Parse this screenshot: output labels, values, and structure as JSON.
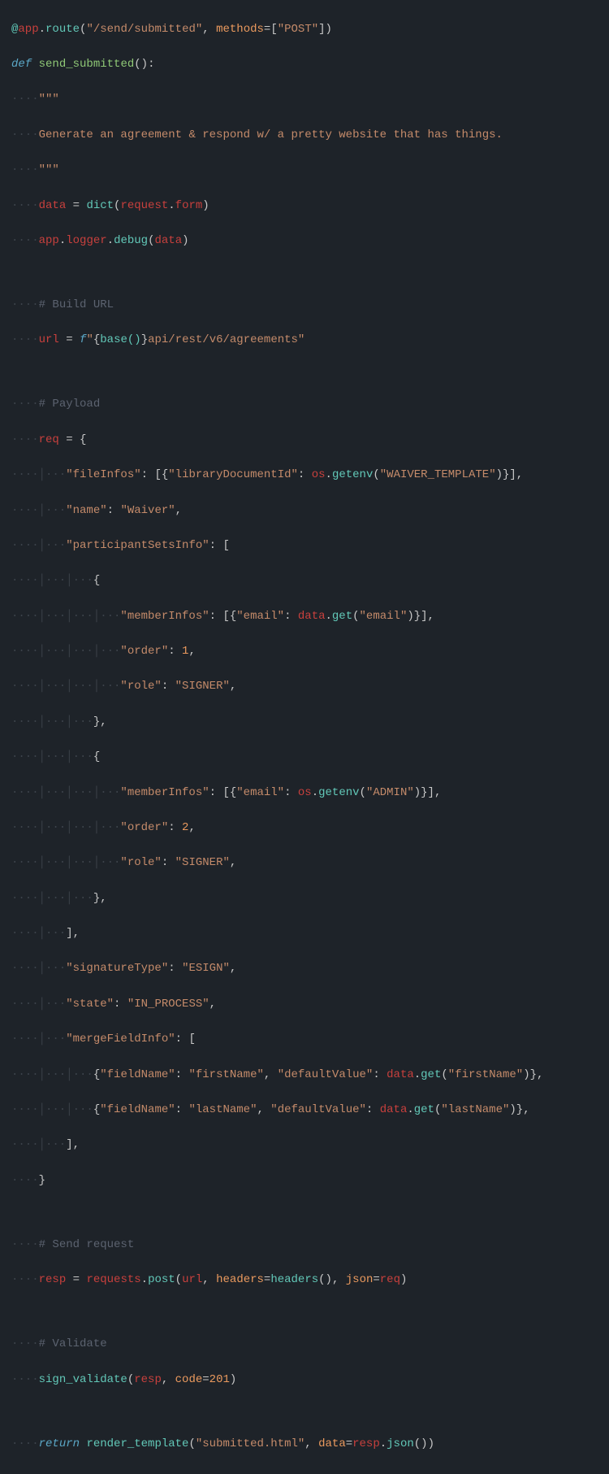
{
  "language": "python",
  "code": {
    "line01": {
      "at": "@",
      "app1": "app",
      "dot1": ".",
      "route": "route",
      "lp": "(",
      "routeStr": "\"/send/submitted\"",
      "comma": ",",
      "space": " ",
      "methods": "methods",
      "eq": "=",
      "lb": "[",
      "post": "\"POST\"",
      "rb": "]",
      "rp": ")"
    },
    "line02": {
      "def": "def",
      "space": " ",
      "name": "send_submitted",
      "lp": "(",
      "rp": ")",
      "colon": ":"
    },
    "line03": {
      "guide": "····",
      "triple": "\"\"\""
    },
    "line04": {
      "guide": "····",
      "text": "Generate an agreement & respond w/ a pretty website that has things."
    },
    "line05": {
      "guide": "····",
      "triple": "\"\"\""
    },
    "line06": {
      "guide": "····",
      "data": "data",
      "eq": " = ",
      "dict": "dict",
      "lp": "(",
      "req": "request",
      "dot": ".",
      "form": "form",
      "rp": ")"
    },
    "line07": {
      "guide": "····",
      "app1": "app",
      "d1": ".",
      "logger": "logger",
      "d2": ".",
      "debug": "debug",
      "lp": "(",
      "data": "data",
      "rp": ")"
    },
    "line08": {
      "guide": ""
    },
    "line09": {
      "guide": "····",
      "text": "# Build URL"
    },
    "line10": {
      "guide": "····",
      "url": "url",
      "eq": " = ",
      "f": "f",
      "open": "\"",
      "lb": "{",
      "base": "base()",
      "rb": "}",
      "rest": "api/rest/v6/agreements\""
    },
    "line11": {
      "guide": ""
    },
    "line12": {
      "guide": "····",
      "text": "# Payload"
    },
    "line13": {
      "guide": "····",
      "req": "req",
      "eq": " = ",
      "brace": "{"
    },
    "line14": {
      "guide": "····│···",
      "key": "\"fileInfos\"",
      "colon": ": ",
      "lb": "[{",
      "libkey": "\"libraryDocumentId\"",
      "colon2": ": ",
      "os": "os",
      "dot": ".",
      "getenv": "getenv",
      "lp": "(",
      "env": "\"WAIVER_TEMPLATE\"",
      "rp": ")",
      "rb": "}],",
      "space": ""
    },
    "line15": {
      "guide": "····│···",
      "key": "\"name\"",
      "colon": ": ",
      "val": "\"Waiver\"",
      "comma": ","
    },
    "line16": {
      "guide": "····│···",
      "key": "\"participantSetsInfo\"",
      "colon": ": ",
      "lb": "["
    },
    "line17": {
      "guide": "····│···│···",
      "brace": "{"
    },
    "line18": {
      "guide": "····│···│···│···",
      "key": "\"memberInfos\"",
      "colon": ": ",
      "lb": "[{",
      "emailkey": "\"email\"",
      "colon2": ": ",
      "data": "data",
      "dot": ".",
      "get": "get",
      "lp": "(",
      "arg": "\"email\"",
      "rp": ")",
      "rb": "}],"
    },
    "line19": {
      "guide": "····│···│···│···",
      "key": "\"order\"",
      "colon": ": ",
      "val": "1",
      "comma": ","
    },
    "line20": {
      "guide": "····│···│···│···",
      "key": "\"role\"",
      "colon": ": ",
      "val": "\"SIGNER\"",
      "comma": ","
    },
    "line21": {
      "guide": "····│···│···",
      "brace": "},",
      "space": ""
    },
    "line22": {
      "guide": "····│···│···",
      "brace": "{"
    },
    "line23": {
      "guide": "····│···│···│···",
      "key": "\"memberInfos\"",
      "colon": ": ",
      "lb": "[{",
      "emailkey": "\"email\"",
      "colon2": ": ",
      "os": "os",
      "dot": ".",
      "getenv": "getenv",
      "lp": "(",
      "arg": "\"ADMIN\"",
      "rp": ")",
      "rb": "}],"
    },
    "line24": {
      "guide": "····│···│···│···",
      "key": "\"order\"",
      "colon": ": ",
      "val": "2",
      "comma": ","
    },
    "line25": {
      "guide": "····│···│···│···",
      "key": "\"role\"",
      "colon": ": ",
      "val": "\"SIGNER\"",
      "comma": ","
    },
    "line26": {
      "guide": "····│···│···",
      "brace": "},",
      "space": ""
    },
    "line27": {
      "guide": "····│···",
      "brace": "],"
    },
    "line28": {
      "guide": "····│···",
      "key": "\"signatureType\"",
      "colon": ": ",
      "val": "\"ESIGN\"",
      "comma": ","
    },
    "line29": {
      "guide": "····│···",
      "key": "\"state\"",
      "colon": ": ",
      "val": "\"IN_PROCESS\"",
      "comma": ","
    },
    "line30": {
      "guide": "····│···",
      "key": "\"mergeFieldInfo\"",
      "colon": ": ",
      "lb": "["
    },
    "line31": {
      "guide": "····│···│···",
      "lb": "{",
      "k1": "\"fieldName\"",
      "c1": ": ",
      "v1": "\"firstName\"",
      "comma1": ", ",
      "k2": "\"defaultValue\"",
      "c2": ": ",
      "data": "data",
      "dot": ".",
      "get": "get",
      "lp": "(",
      "arg": "\"firstName\"",
      "rp": ")",
      "rb": "},"
    },
    "line32": {
      "guide": "····│···│···",
      "lb": "{",
      "k1": "\"fieldName\"",
      "c1": ": ",
      "v1": "\"lastName\"",
      "comma1": ", ",
      "k2": "\"defaultValue\"",
      "c2": ": ",
      "data": "data",
      "dot": ".",
      "get": "get",
      "lp": "(",
      "arg": "\"lastName\"",
      "rp": ")",
      "rb": "},"
    },
    "line33": {
      "guide": "····│···",
      "brace": "],"
    },
    "line34": {
      "guide": "····",
      "brace": "}"
    },
    "line35": {
      "guide": ""
    },
    "line36": {
      "guide": "····",
      "text": "# Send request"
    },
    "line37": {
      "guide": "····",
      "resp": "resp",
      "eq": " = ",
      "requests": "requests",
      "dot": ".",
      "post": "post",
      "lp": "(",
      "url": "url",
      "c1": ", ",
      "headers": "headers",
      "eq2": "=",
      "headersfn": "headers",
      "lp2": "(",
      "rp2": ")",
      "c2": ", ",
      "json": "json",
      "eq3": "=",
      "req": "req",
      "rp": ")"
    },
    "line38": {
      "guide": ""
    },
    "line39": {
      "guide": "····",
      "text": "# Validate"
    },
    "line40": {
      "guide": "····",
      "fn": "sign_validate",
      "lp": "(",
      "resp": "resp",
      "c": ", ",
      "code": "code",
      "eq": "=",
      "val": "201",
      "rp": ")"
    },
    "line41": {
      "guide": ""
    },
    "line42": {
      "guide": "····",
      "return": "return",
      "sp": " ",
      "fn": "render_template",
      "lp": "(",
      "tpl": "\"submitted.html\"",
      "c": ", ",
      "data": "data",
      "eq": "=",
      "resp": "resp",
      "dot": ".",
      "json": "json",
      "lp2": "(",
      "rp2": ")",
      "rp": ")"
    }
  }
}
